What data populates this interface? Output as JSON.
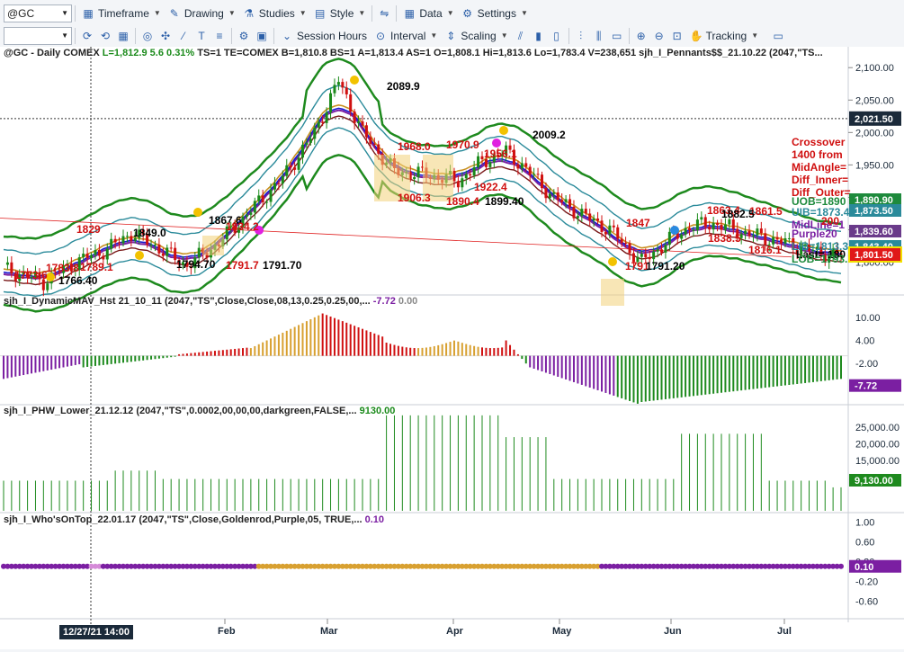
{
  "toolbar1": {
    "symbol": "@GC",
    "items": [
      {
        "label": "Timeframe",
        "icon": "timeframe-icon"
      },
      {
        "label": "Drawing",
        "icon": "pencil-icon"
      },
      {
        "label": "Studies",
        "icon": "flask-icon"
      },
      {
        "label": "Style",
        "icon": "style-icon"
      },
      {
        "label": "Data",
        "icon": "grid-icon"
      },
      {
        "label": "Settings",
        "icon": "gear-icon"
      }
    ]
  },
  "toolbar2": {
    "session_hours": "Session Hours",
    "interval": "Interval",
    "scaling": "Scaling",
    "tracking": "Tracking"
  },
  "status_line": {
    "prefix": "@GC - Daily  COMEX",
    "last": "L=1,812.9",
    "change": "5.6",
    "change_pct": "0.31%",
    "rest": "TS=1  TE=COMEX  B=1,810.8  BS=1  A=1,813.4  AS=1  O=1,808.1  Hi=1,813.6  Lo=1,783.4  V=238,651  sjh_I_Pennants$$_21.10.22 (2047,\"TS..."
  },
  "price_pane": {
    "axis_ticks": [
      "2,100.00",
      "2,050.00",
      "2,000.00",
      "1,950.00",
      "1,900.00",
      "1,850.00",
      "1,800.00"
    ],
    "axis_ticks_values": [
      2100,
      2050,
      2000,
      1950,
      1900,
      1850,
      1800
    ],
    "crosshair_price": "2,021.50",
    "annotations": [
      {
        "text": "2089.9",
        "color": "#000000"
      },
      {
        "text": "2009.2",
        "color": "#000000"
      },
      {
        "text": "1968.0",
        "color": "#d01010"
      },
      {
        "text": "1970.9",
        "color": "#d01010"
      },
      {
        "text": "1956.1",
        "color": "#d01010"
      },
      {
        "text": "1906.3",
        "color": "#d01010"
      },
      {
        "text": "1890.4",
        "color": "#d01010"
      },
      {
        "text": "1922.4",
        "color": "#d01010"
      },
      {
        "text": "1899.40",
        "color": "#000000"
      },
      {
        "text": "1867.6",
        "color": "#000000"
      },
      {
        "text": "1834.2",
        "color": "#d01010"
      },
      {
        "text": "1849.0",
        "color": "#000000"
      },
      {
        "text": "1829",
        "color": "#d01010"
      },
      {
        "text": "1794.70",
        "color": "#000000"
      },
      {
        "text": "1791.7",
        "color": "#d01010"
      },
      {
        "text": "1791.70",
        "color": "#000000"
      },
      {
        "text": "1766.40",
        "color": "#000000"
      },
      {
        "text": "1773.6",
        "color": "#d01010"
      },
      {
        "text": "1783.8",
        "color": "#d01010"
      },
      {
        "text": "1789.1",
        "color": "#d01010"
      },
      {
        "text": "1791",
        "color": "#d01010"
      },
      {
        "text": "1791.20",
        "color": "#000000"
      },
      {
        "text": "1847",
        "color": "#d01010"
      },
      {
        "text": "1863.4",
        "color": "#d01010"
      },
      {
        "text": "1861.5",
        "color": "#d01010"
      },
      {
        "text": "1882.5",
        "color": "#000000"
      },
      {
        "text": "1838.5",
        "color": "#d01010"
      },
      {
        "text": "1816.1",
        "color": "#d01010"
      },
      {
        "text": "Last= 180",
        "color": "#000000"
      }
    ],
    "right_legend": {
      "crossover": "Crossover",
      "from": "1400 from",
      "midangle": "MidAngle=",
      "diff_inner": "Diff_Inner=",
      "diff_outer": "Diff_Outer=",
      "uob": "UOB=1890",
      "uib": "UIB=1873.4",
      "midline": "MidLine=1",
      "midline_val": "200",
      "purple": "Purple20",
      "lib": "LIB=1813.3",
      "lob": "LOB=1793.7"
    },
    "value_badges": [
      {
        "text": "1,890.90",
        "color": "#1e8a3c"
      },
      {
        "text": "1,873.50",
        "color": "#2a8a9a"
      },
      {
        "text": "1,839.60",
        "color": "#6a3a8a"
      },
      {
        "text": "1,843.40",
        "color": "#2a8a9a"
      },
      {
        "text": "1,801.50",
        "color": "#e01818"
      }
    ]
  },
  "dynamic_mav_pane": {
    "label": "sjh_I_DynamicMAV_Hst 21_10_11 (2047,\"TS\",Close,Close,08,13,0.25,0.25,00,...",
    "value1": "-7.72",
    "value2": "0.00",
    "axis_ticks": [
      "10.00",
      "4.00",
      "-2.00"
    ],
    "axis_ticks_values": [
      10,
      4,
      -2
    ],
    "badge": "-7.72"
  },
  "phw_pane": {
    "label": "sjh_I_PHW_Lower_21.12.12 (2047,\"TS\",0.0002,00,00,00,darkgreen,FALSE,...",
    "value": "9130.00",
    "axis_ticks": [
      "25,000.00",
      "20,000.00",
      "15,000.00",
      "10,000.00"
    ],
    "axis_ticks_values": [
      25000,
      20000,
      15000,
      10000
    ],
    "badge": "9,130.00"
  },
  "whos_on_top_pane": {
    "label": "sjh_I_Who'sOnTop_22.01.17 (2047,\"TS\",Close,Goldenrod,Purple,05, TRUE,...",
    "value": "0.10",
    "axis_ticks": [
      "1.00",
      "0.60",
      "0.20",
      "-0.20",
      "-0.60"
    ],
    "axis_ticks_values": [
      1.0,
      0.6,
      0.2,
      -0.2,
      -0.6
    ],
    "badge": "0.10"
  },
  "time_axis": {
    "labels": [
      "Feb",
      "Mar",
      "Apr",
      "May",
      "Jun",
      "Jul"
    ],
    "crosshair_date": "12/27/21 14:00"
  }
}
